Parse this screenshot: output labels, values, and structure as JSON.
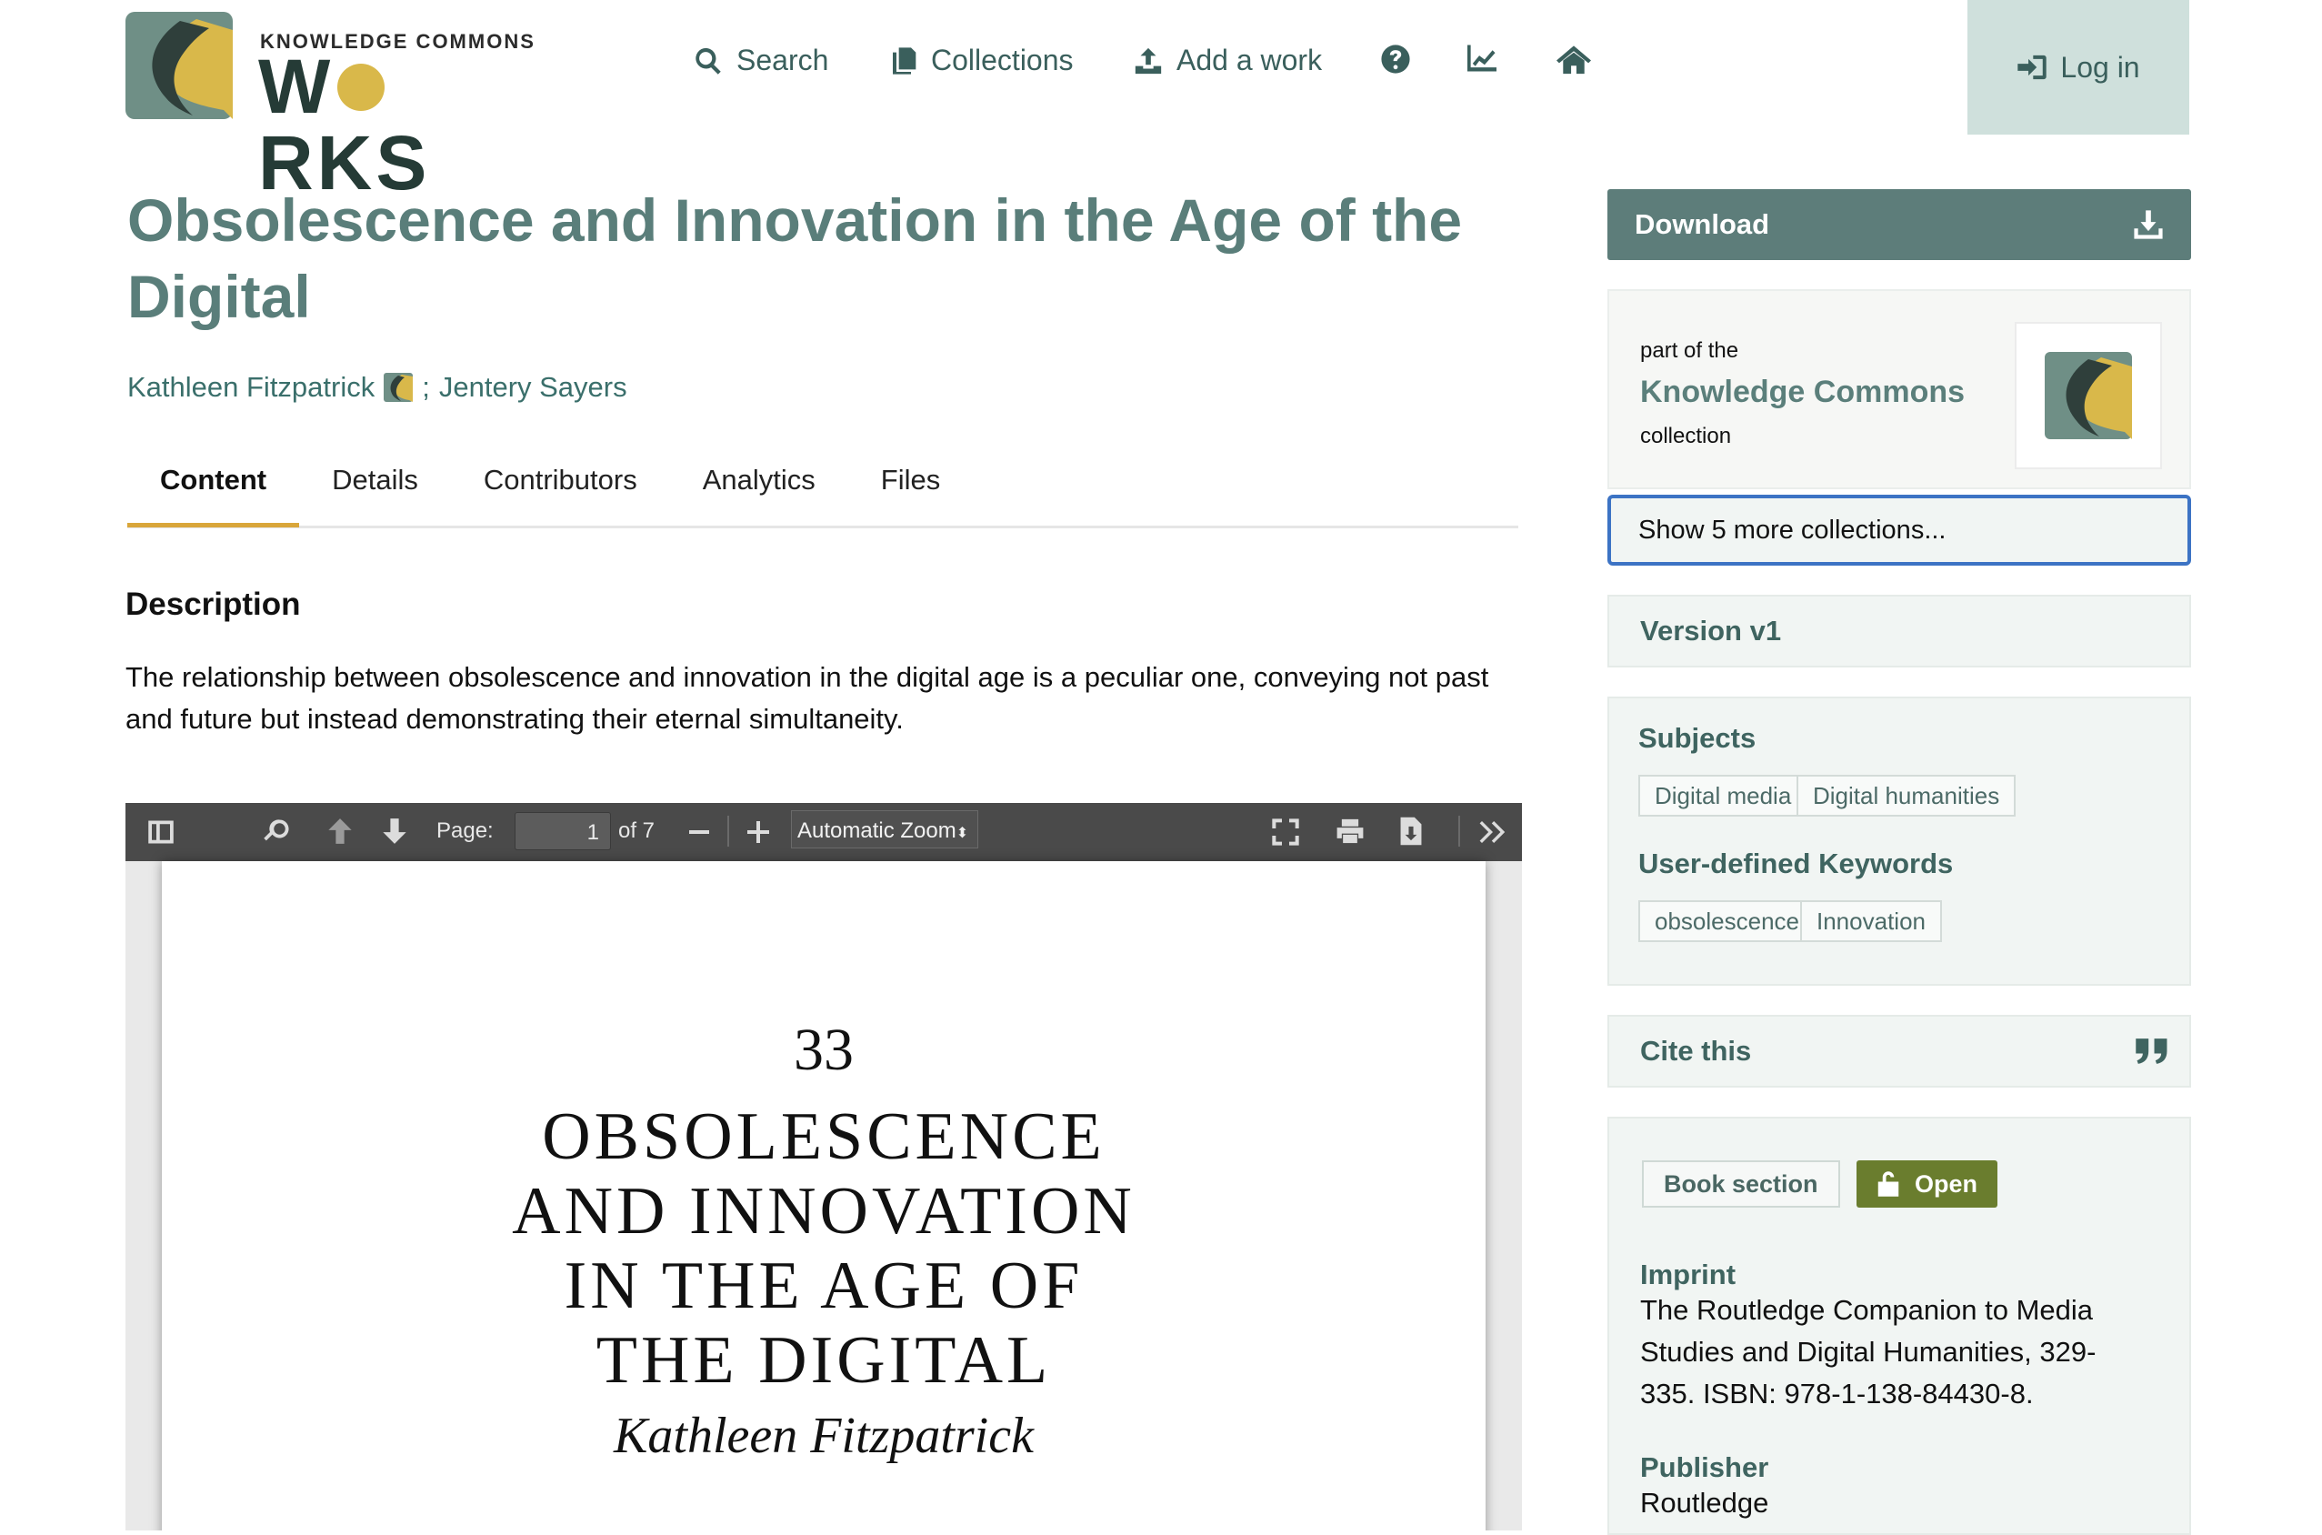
{
  "header": {
    "logo_small": "KNOWLEDGE COMMONS",
    "logo_big_pre": "W",
    "logo_big_post": "RKS",
    "nav": {
      "search": "Search",
      "collections": "Collections",
      "add_work": "Add a work"
    },
    "login": "Log in"
  },
  "work": {
    "title": "Obsolescence and Innovation in the Age of the Digital",
    "author1": "Kathleen Fitzpatrick",
    "separator": ";",
    "author2": "Jentery Sayers"
  },
  "tabs": [
    "Content",
    "Details",
    "Contributors",
    "Analytics",
    "Files"
  ],
  "description": {
    "heading": "Description",
    "text": "The relationship between obsolescence and innovation in the digital age is a peculiar one, conveying not past and future but instead demonstrating their eternal simultaneity."
  },
  "pdf": {
    "page_label": "Page:",
    "page_value": "1",
    "page_of": "of 7",
    "zoom": "Automatic Zoom",
    "page_number": "33",
    "chapter_title_lines": [
      "OBSOLESCENCE",
      "AND INNOVATION",
      "IN THE AGE OF",
      "THE DIGITAL"
    ],
    "chapter_author": "Kathleen Fitzpatrick"
  },
  "sidebar": {
    "download": "Download",
    "collection": {
      "part_of": "part of the",
      "name": "Knowledge Commons",
      "suffix": "collection"
    },
    "show_more": "Show 5 more collections...",
    "version": "Version v1",
    "subjects_heading": "Subjects",
    "subjects": [
      "Digital media",
      "Digital humanities"
    ],
    "keywords_heading": "User-defined Keywords",
    "keywords": [
      "obsolescence",
      "Innovation"
    ],
    "cite": "Cite this",
    "resource_type": "Book section",
    "access": "Open",
    "imprint_heading": "Imprint",
    "imprint": "The Routledge Companion to Media Studies and Digital Humanities, 329-335. ISBN: 978-1-138-84430-8.",
    "publisher_heading": "Publisher",
    "publisher": "Routledge"
  },
  "colors": {
    "brand_teal": "#5d7d7a",
    "brand_gold": "#d9b84a",
    "open_green": "#6a7d2e",
    "focus_blue": "#3c73c4"
  }
}
